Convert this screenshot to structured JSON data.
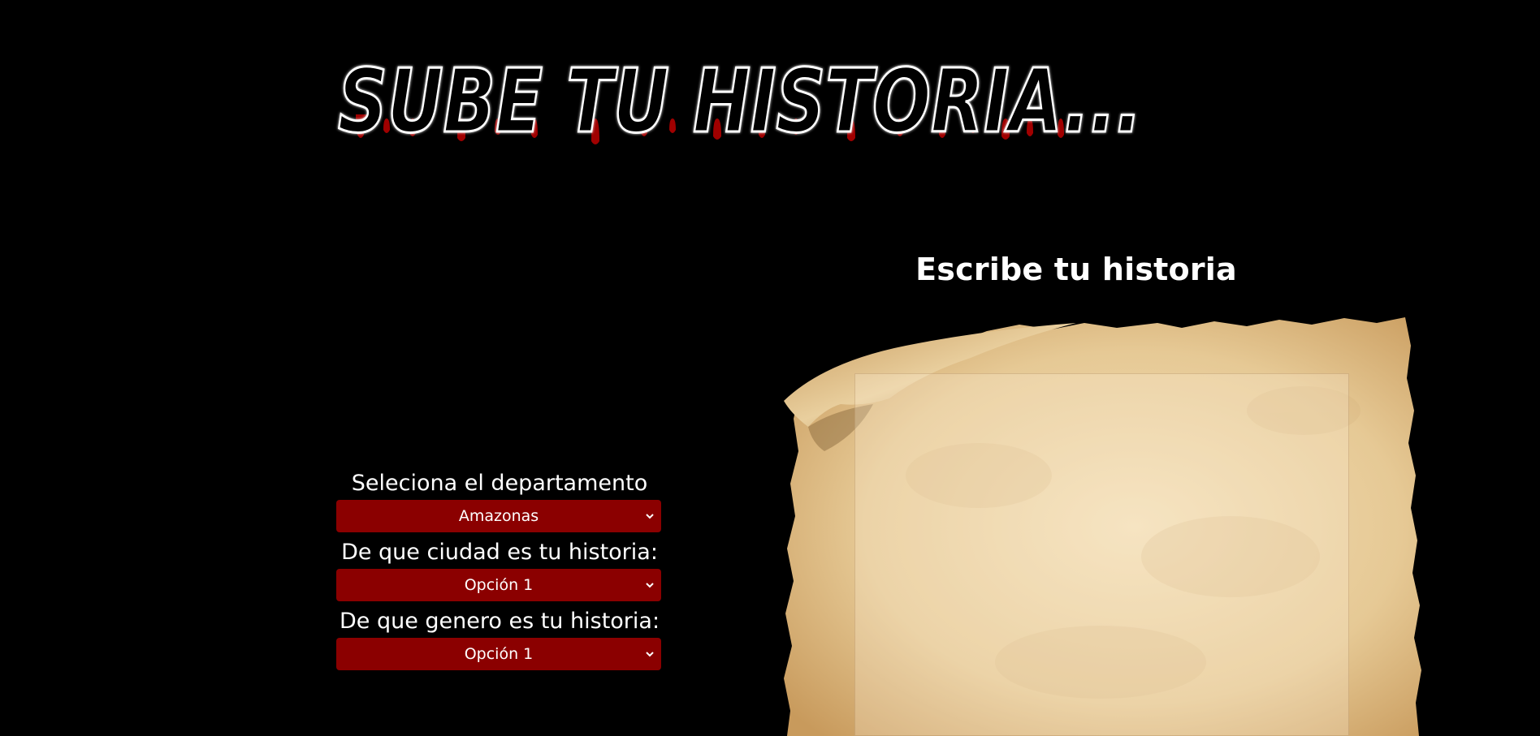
{
  "header": {
    "title": "SUBE TU HISTORIA..."
  },
  "paper": {
    "heading": "Escribe tu historia",
    "textarea_value": ""
  },
  "form": {
    "department": {
      "label": "Seleciona el departamento",
      "selected": "Amazonas"
    },
    "city": {
      "label": "De que ciudad es tu historia:",
      "selected": "Opción 1"
    },
    "genre": {
      "label": "De que genero es tu historia:",
      "selected": "Opción 1"
    }
  },
  "colors": {
    "background": "#000000",
    "select_bg": "#8b0000",
    "blood": "#a00000",
    "title_text": "#000000",
    "parchment": "#e8cc9a"
  },
  "icons": {
    "select_chevron": "chevron-down-icon",
    "title_drips": "blood-drip-decoration"
  }
}
